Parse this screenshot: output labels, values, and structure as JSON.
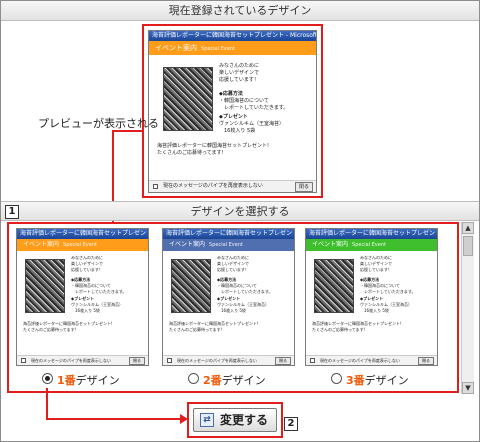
{
  "sections": {
    "current_design_title": "現在登録されているデザイン",
    "select_design_title": "デザインを選択する"
  },
  "annotations": {
    "preview_note": "プレビューが表示される",
    "badge_1": "1",
    "badge_2": "2"
  },
  "preview": {
    "titlebar": "海苔評価レポーターに韓国海苔セットプレゼント - Microsoft",
    "header": "イベント案内",
    "header_sub": "Special Event",
    "intro": "みなさんのために\n楽しいデザインで\n応援しています！",
    "method_heading": "◆応募方法",
    "method_body": "・韓国海苔のについて\n　レポートしていただきます。",
    "present_heading": "◆プレゼント",
    "present_body": "ヴァンシルキム（王室海苔）\n　16枚入り 5袋",
    "footer_text": "海苔評価レポーターに韓国海苔セットプレゼント!\nたくさんのご応募待ってます!",
    "checkbox_label": "現在のメッセージのパイプを再度表示しない",
    "close_label": "閉る"
  },
  "options": [
    {
      "number": "1番",
      "suffix": "デザイン",
      "selected": true,
      "accent": "#ff9c1a"
    },
    {
      "number": "2番",
      "suffix": "デザイン",
      "selected": false,
      "accent": "#4f6fb0"
    },
    {
      "number": "3番",
      "suffix": "デザイン",
      "selected": false,
      "accent": "#3fbf2e"
    }
  ],
  "action": {
    "change_label": "変更する",
    "change_icon": "refresh-icon"
  },
  "colors": {
    "highlight_red": "#e11d1d",
    "number_orange": "#f05a0a"
  }
}
